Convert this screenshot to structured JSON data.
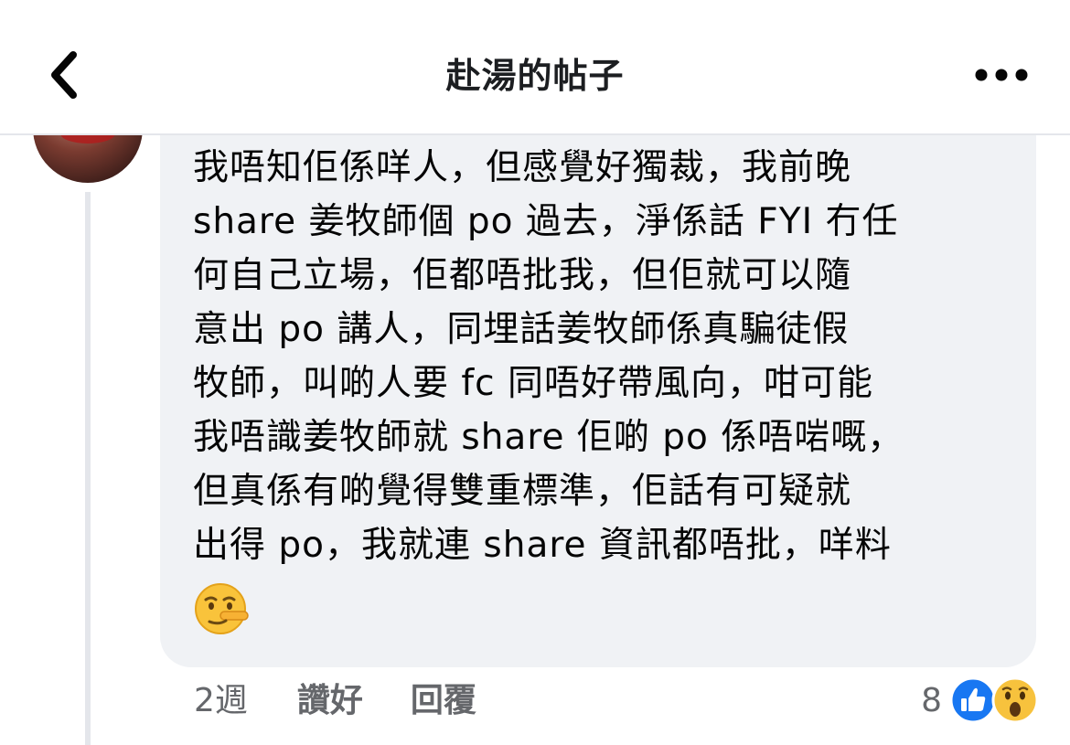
{
  "header": {
    "title": "赴湯的帖子",
    "back_icon": "chevron-left-icon",
    "more_icon": "more-horizontal-icon"
  },
  "comment": {
    "text": "我唔知佢係咩人，但感覺好獨裁，我前晚\nshare 姜牧師個 po 過去，淨係話 FYI 冇任\n何自己立場，佢都唔批我，但佢就可以隨\n意出 po 講人，同埋話姜牧師係真騙徒假\n牧師，叫啲人要 fc 同唔好帶風向，咁可能\n我唔識姜牧師就 share 佢啲 po 係唔啱嘅，\n但真係有啲覺得雙重標準，佢話有可疑就\n出得 po，我就連 share 資訊都唔批，咩料",
    "emoji": "lying-face-emoji",
    "timestamp": "2週",
    "like_label": "讚好",
    "reply_label": "回覆",
    "reaction_count": "8",
    "reactions": [
      "like-reaction-icon",
      "wow-reaction-icon"
    ]
  },
  "colors": {
    "bubble": "#f0f2f5",
    "secondary_text": "#65676b",
    "like_blue": "#1877f2"
  }
}
